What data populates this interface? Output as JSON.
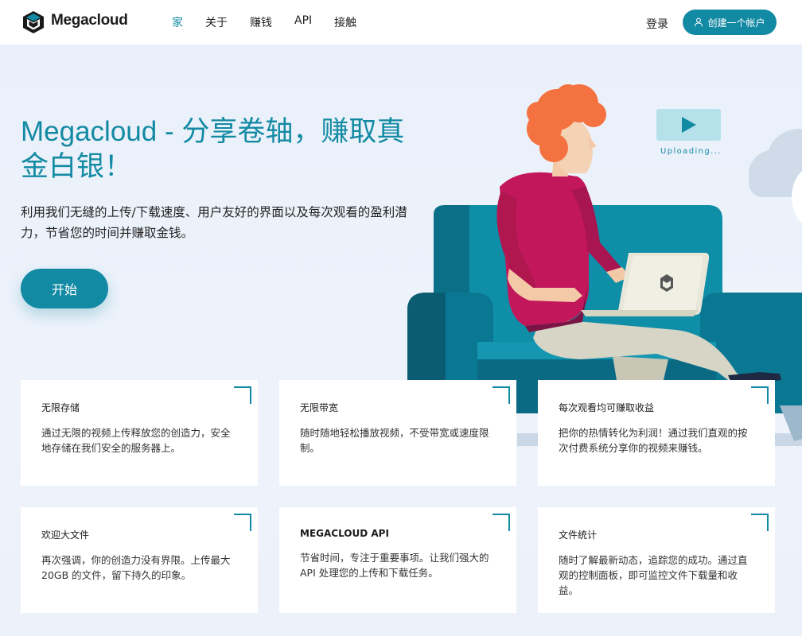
{
  "header": {
    "brand": "Megacloud",
    "nav": [
      {
        "label": "家",
        "active": true
      },
      {
        "label": "关于",
        "active": false
      },
      {
        "label": "赚钱",
        "active": false
      },
      {
        "label": "API",
        "active": false
      },
      {
        "label": "接触",
        "active": false
      }
    ],
    "login_label": "登录",
    "signup_label": "创建一个帐户"
  },
  "hero": {
    "title": "Megacloud - 分享卷轴，赚取真金白银！",
    "description": "利用我们无缝的上传/下载速度、用户友好的界面以及每次观看的盈利潜力，节省您的时间并赚取金钱。",
    "cta_label": "开始",
    "upload_status": "Uploading..."
  },
  "features": [
    {
      "title": "无限存储",
      "text": "通过无限的视频上传释放您的创造力，安全地存储在我们安全的服务器上。"
    },
    {
      "title": "无限带宽",
      "text": "随时随地轻松播放视频，不受带宽或速度限制。"
    },
    {
      "title": "每次观看均可赚取收益",
      "text": "把你的热情转化为利润！通过我们直观的按次付费系统分享你的视频来赚钱。"
    },
    {
      "title": "欢迎大文件",
      "text": "再次强调，你的创造力没有界限。上传最大 20GB 的文件，留下持久的印象。"
    },
    {
      "title": "MEGACLOUD API",
      "text": "节省时间，专注于重要事项。让我们强大的 API 处理您的上传和下载任务。"
    },
    {
      "title": "文件统计",
      "text": "随时了解最新动态，追踪您的成功。通过直观的控制面板，即可监控文件下载量和收益。"
    }
  ],
  "colors": {
    "accent": "#138aa3",
    "sofa": "#0f8ea8",
    "shirt": "#c2185b",
    "hair": "#f4723f"
  }
}
